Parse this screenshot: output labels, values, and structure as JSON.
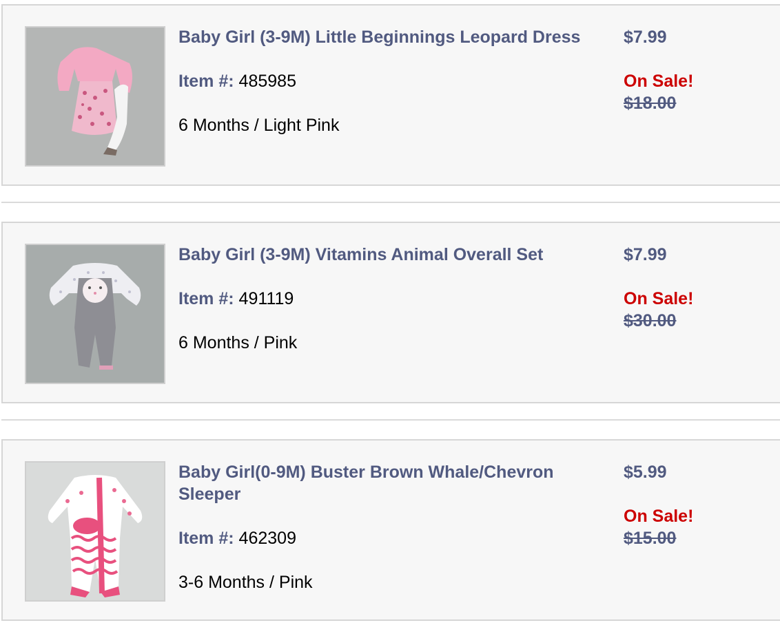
{
  "labels": {
    "item_number": "Item #:",
    "on_sale": "On Sale!"
  },
  "colors": {
    "title": "#515a80",
    "sale": "#cc0000",
    "card_background": "#f7f7f7",
    "card_border": "#d6d6d6"
  },
  "items": [
    {
      "title": "Baby Girl (3-9M) Little Beginnings Leopard Dress",
      "item_number": "485985",
      "variant": "6 Months / Light Pink",
      "price": "$7.99",
      "original_price": "$18.00",
      "image": "leopard-dress-product-photo"
    },
    {
      "title": "Baby Girl (3-9M) Vitamins Animal Overall Set",
      "item_number": "491119",
      "variant": "6 Months / Pink",
      "price": "$7.99",
      "original_price": "$30.00",
      "image": "animal-overall-set-product-photo"
    },
    {
      "title": "Baby Girl(0-9M) Buster Brown Whale/Chevron Sleeper",
      "item_number": "462309",
      "variant": "3-6 Months / Pink",
      "price": "$5.99",
      "original_price": "$15.00",
      "image": "whale-chevron-sleeper-product-photo"
    }
  ]
}
